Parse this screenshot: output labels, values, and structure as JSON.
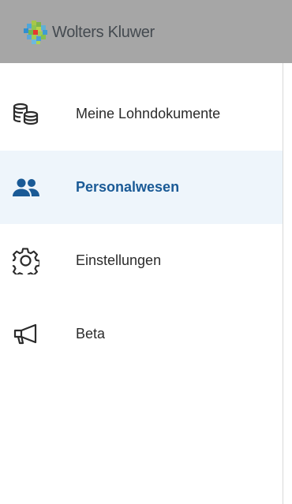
{
  "header": {
    "brand_name": "Wolters Kluwer",
    "background_color": "#a6a6a6"
  },
  "nav": {
    "items": [
      {
        "label": "Meine Lohndokumente",
        "icon": "coins-stack-icon",
        "active": false
      },
      {
        "label": "Personalwesen",
        "icon": "users-icon",
        "active": true
      },
      {
        "label": "Einstellungen",
        "icon": "gear-icon",
        "active": false
      },
      {
        "label": "Beta",
        "icon": "megaphone-icon",
        "active": false
      }
    ],
    "active_color": "#1a5a96",
    "active_background": "#eef5fb"
  }
}
